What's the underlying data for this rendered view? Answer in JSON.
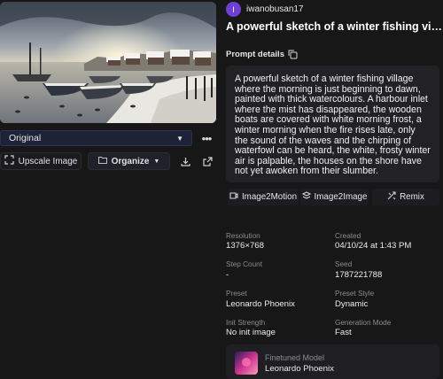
{
  "image": {
    "alt": ""
  },
  "controls": {
    "variant_value": "Original",
    "more_label": "•••",
    "upscale_label": "Upscale Image",
    "organize_label": "Organize"
  },
  "author": {
    "initial": "I",
    "username": "iwanobusan17",
    "avatar_color": "#6f3fd6"
  },
  "title": "A powerful sketch of a winter fishing village drifting in the morning",
  "prompt": {
    "label": "Prompt details",
    "text": "A powerful sketch of a winter fishing village where the morning is just beginning to dawn, painted with thick watercolours. A harbour inlet where the mist has disappeared, the wooden boats are covered with white morning frost, a winter morning when the fire rises late, only the sound of the waves and the chirping of waterfowl can be heard, the white, frosty winter air is palpable, the houses on the shore have not yet awoken from their slumber."
  },
  "actions": [
    {
      "label": "Image2Motion",
      "icon": "motion-icon"
    },
    {
      "label": "Image2Image",
      "icon": "layers-icon"
    },
    {
      "label": "Remix",
      "icon": "remix-icon"
    }
  ],
  "meta": {
    "resolution_label": "Resolution",
    "resolution": "1376×768",
    "created_label": "Created",
    "created": "04/10/24 at 1:43 PM",
    "step_count_label": "Step Count",
    "step_count": "-",
    "seed_label": "Seed",
    "seed": "1787221788",
    "preset_label": "Preset",
    "preset": "Leonardo Phoenix",
    "preset_style_label": "Preset Style",
    "preset_style": "Dynamic",
    "init_strength_label": "Init Strength",
    "init_strength": "No init image",
    "generation_mode_label": "Generation Mode",
    "generation_mode": "Fast"
  },
  "finetuned": {
    "label": "Finetuned Model",
    "value": "Leonardo Phoenix"
  }
}
